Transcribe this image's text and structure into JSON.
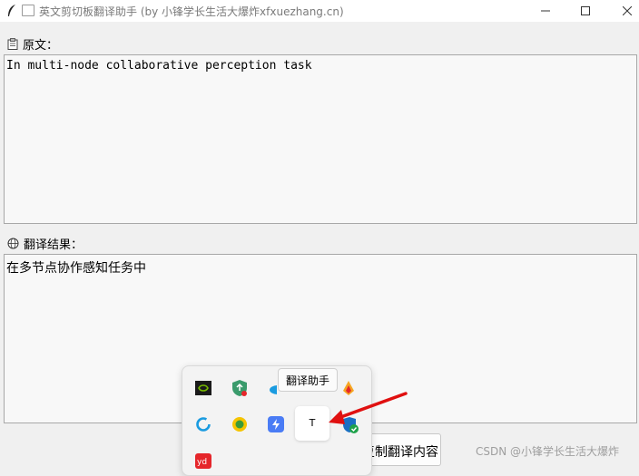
{
  "window": {
    "title": "英文剪切板翻译助手 (by 小锋学长生活大爆炸xfxuezhang.cn)"
  },
  "original": {
    "label": "原文：",
    "text": "In multi-node collaborative perception task"
  },
  "result": {
    "label": "翻译结果：",
    "text": "在多节点协作感知任务中"
  },
  "bottom": {
    "button_label": "复制翻译内容"
  },
  "tray": {
    "tooltip": "翻译助手",
    "hovered_icon_text": "T"
  },
  "watermark": "CSDN @小锋学长生活大爆炸",
  "colors": {
    "arrow": "#e01010",
    "nvidia": "#76b900",
    "shield": "#3a9b6c",
    "onedrive": "#1a9be0",
    "blue_badge": "#4a7cf5",
    "yd": "#e5262b"
  }
}
